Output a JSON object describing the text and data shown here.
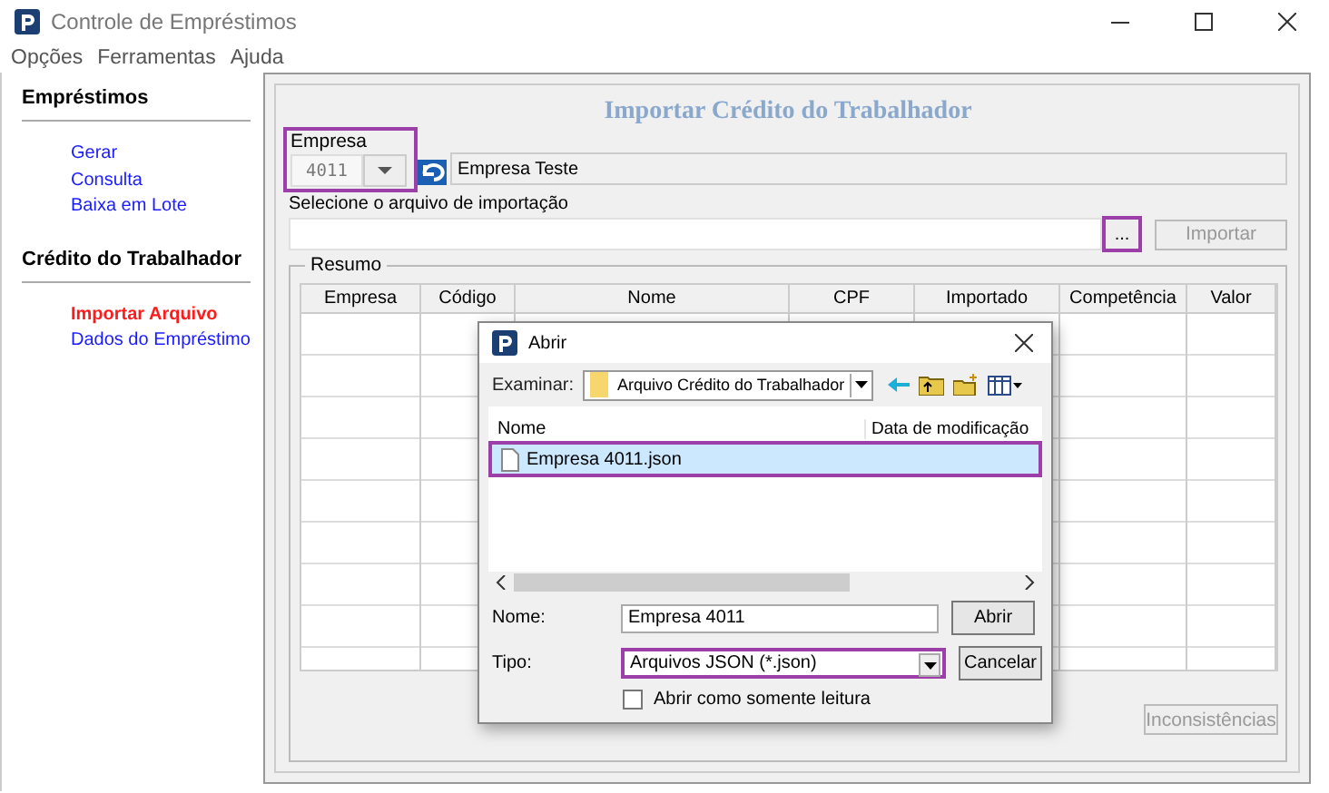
{
  "window": {
    "title": "Controle de Empréstimos"
  },
  "menu": [
    "Opções",
    "Ferramentas",
    "Ajuda"
  ],
  "sidebar": {
    "sections": [
      {
        "heading": "Empréstimos",
        "items": [
          {
            "label": "Gerar",
            "selected": false
          },
          {
            "label": "Consulta",
            "selected": false
          },
          {
            "label": "Baixa em Lote",
            "selected": false
          }
        ]
      },
      {
        "heading": "Crédito do Trabalhador",
        "items": [
          {
            "label": "Importar Arquivo",
            "selected": true
          },
          {
            "label": "Dados do Empréstimo",
            "selected": false
          }
        ]
      }
    ]
  },
  "form": {
    "title": "Importar Crédito do Trabalhador",
    "empresa": {
      "label": "Empresa",
      "code": "4011",
      "name": "Empresa Teste",
      "highlighted": true
    },
    "file": {
      "label": "Selecione o arquivo de importação",
      "browse_button": "...",
      "browse_highlighted": true,
      "import_button": {
        "label": "Importar",
        "disabled": true
      }
    },
    "resumo": {
      "legend": "Resumo",
      "columns": [
        "Empresa",
        "Código",
        "Nome",
        "CPF",
        "Importado",
        "Competência",
        "Valor"
      ],
      "button": {
        "label": "Inconsistências",
        "disabled": true
      }
    }
  },
  "dialog": {
    "title": "Abrir",
    "look_in_label": "Examinar:",
    "look_in_value": "Arquivo Crédito do Trabalhador",
    "columns": [
      "Nome",
      "Data de modificação"
    ],
    "files": [
      {
        "name": "Empresa 4011.json",
        "selected": true,
        "highlighted": true
      }
    ],
    "name_label": "Nome:",
    "name_value": "Empresa 4011",
    "type_label": "Tipo:",
    "type_value": "Arquivos JSON (*.json)",
    "type_highlighted": true,
    "open_button": "Abrir",
    "cancel_button": "Cancelar",
    "readonly_label": "Abrir como somente leitura",
    "readonly_checked": false
  }
}
